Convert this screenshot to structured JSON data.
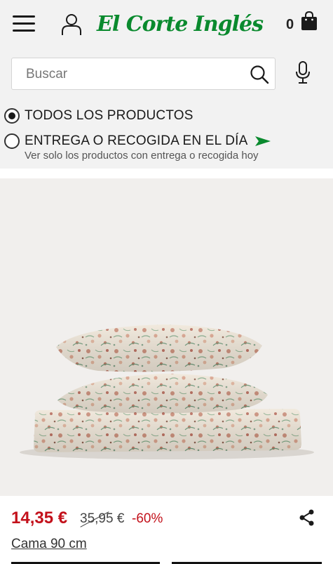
{
  "header": {
    "menu_icon": "hamburger-menu-icon",
    "user_icon": "user-account-icon",
    "logo_text": "El Corte Inglés",
    "cart_count": "0",
    "cart_icon": "shopping-bag-icon",
    "brand_color": "#0a8a2e"
  },
  "search": {
    "placeholder": "Buscar",
    "value": "",
    "search_icon": "search-icon",
    "mic_icon": "microphone-icon"
  },
  "filters": {
    "all_products": {
      "label": "TODOS LOS PRODUCTOS",
      "checked": true
    },
    "same_day": {
      "label": "ENTREGA O RECOGIDA EN EL DÍA",
      "checked": false,
      "sub_label": "Ver solo los productos con entrega o recogida hoy",
      "flag_icon": "green-flag-icon"
    }
  },
  "product": {
    "image_icon": "bedding-set-image",
    "price": "14,35 €",
    "old_price": "35,95 €",
    "discount": "-60%",
    "size": "Cama 90 cm",
    "share_icon": "share-icon",
    "price_color": "#c3111b"
  }
}
